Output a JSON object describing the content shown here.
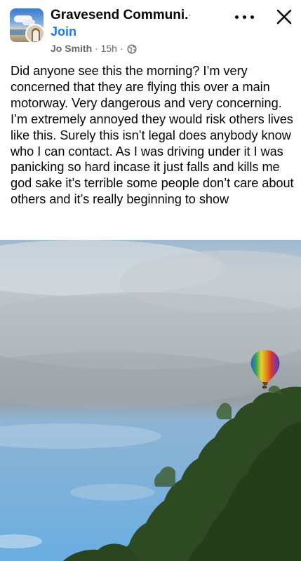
{
  "header": {
    "group_name": "Gravesend Communi...",
    "name_separator": "·",
    "join_label": "Join",
    "author": "Jo Smith",
    "meta_separator": "·",
    "time_ago": "15h",
    "visibility_icon": "globe-icon",
    "more_icon": "more-options-icon",
    "close_icon": "close-icon"
  },
  "post": {
    "text": "Did anyone see this the morning? I’m very concerned that they are flying this over a main motorway. Very dangerous and very concerning. I’m extremely annoyed they would risk others lives like this. Surely this isn’t legal does anybody know who I can contact. As I was driving under it I was panicking so hard incase it just falls and kills me god sake it’s terrible some people don’t care about others and it’s really beginning to show"
  },
  "photo": {
    "subject": "hot-air-balloon-over-trees"
  },
  "colors": {
    "link": "#1877f2",
    "secondary_text": "#65676b",
    "primary_text": "#050505"
  }
}
